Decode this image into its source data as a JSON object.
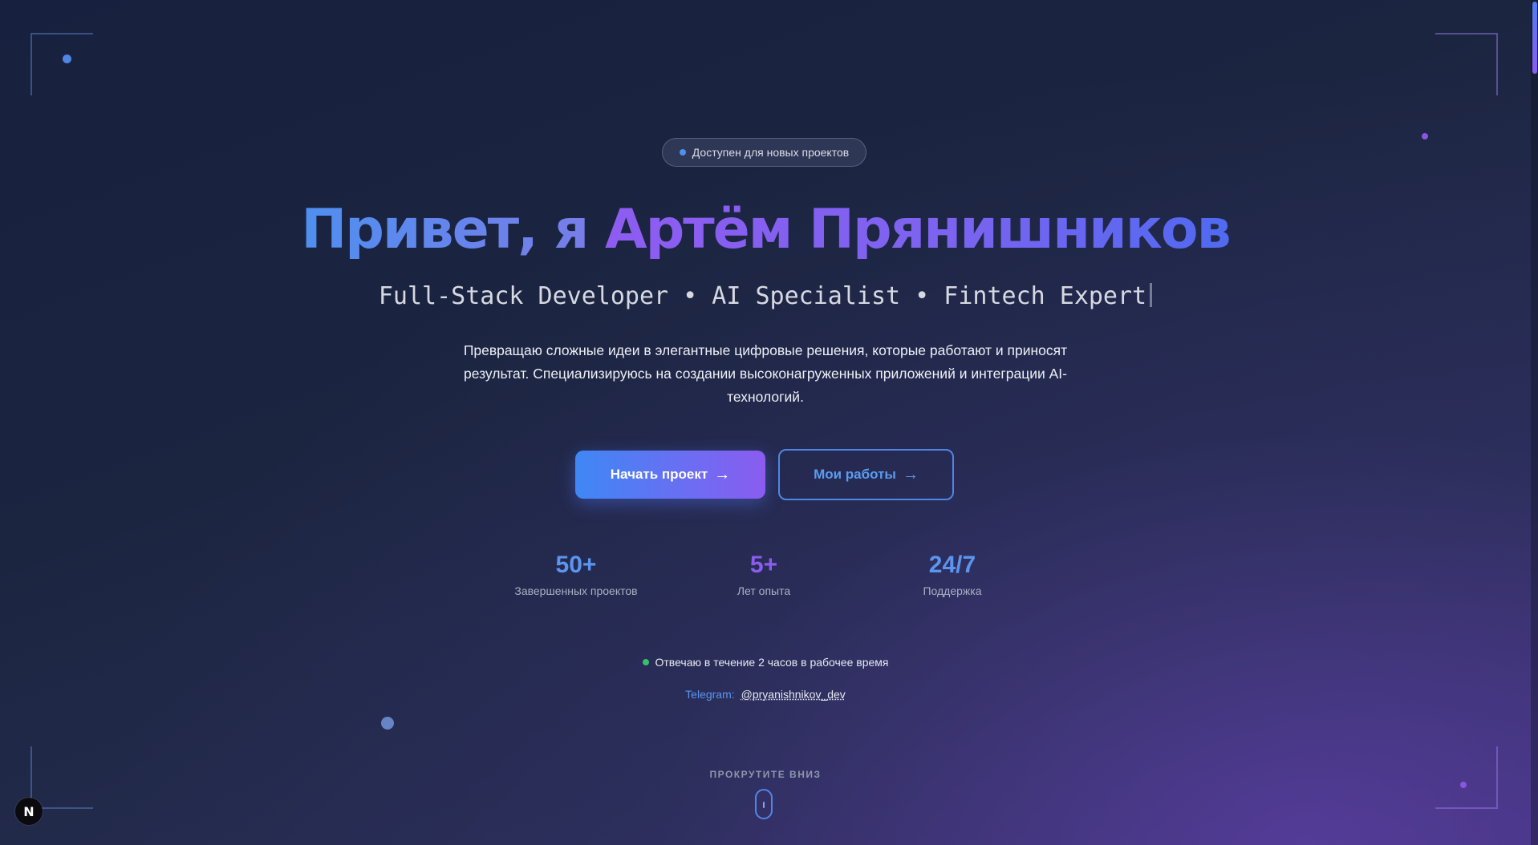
{
  "badge": {
    "text": "Доступен для новых проектов"
  },
  "hero": {
    "greeting": "Привет, я ",
    "name": "Артём Прянишников",
    "roles": "Full-Stack Developer • AI Specialist • Fintech Expert",
    "description": "Превращаю сложные идеи в элегантные цифровые решения, которые работают и приносят результат. Специализируюсь на создании высоконагруженных приложений и интеграции AI-технологий."
  },
  "buttons": {
    "primary": {
      "label": "Начать проект",
      "arrow": "→"
    },
    "secondary": {
      "label": "Мои работы",
      "arrow": "→"
    }
  },
  "stats": [
    {
      "value": "50+",
      "label": "Завершенных проектов"
    },
    {
      "value": "5+",
      "label": "Лет опыта"
    },
    {
      "value": "24/7",
      "label": "Поддержка"
    }
  ],
  "response": {
    "text": "Отвечаю в течение 2 часов в рабочее время"
  },
  "telegram": {
    "label": "Telegram:",
    "handle": "@pryanishnikov_dev"
  },
  "scroll_hint": {
    "text": "ПРОКРУТИТЕ ВНИЗ"
  },
  "dev_badge": {
    "text": "N"
  },
  "colors": {
    "accent_blue": "#4f8ff0",
    "accent_purple": "#8a5cf0",
    "status_green": "#37c26a",
    "background": "#1b2540"
  },
  "icons": {
    "status": "status-dot-icon",
    "online": "online-dot-icon",
    "arrow": "arrow-right-icon",
    "scroll": "mouse-scroll-icon"
  }
}
